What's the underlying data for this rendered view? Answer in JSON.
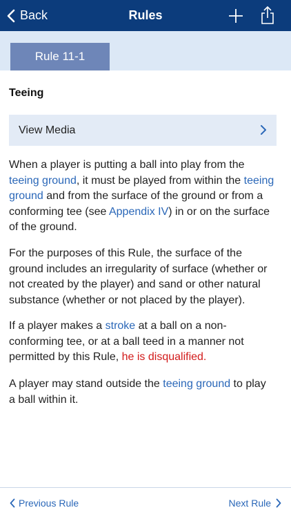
{
  "nav": {
    "back_label": "Back",
    "title": "Rules",
    "icons": [
      "chevron-left-icon",
      "plus-icon",
      "share-icon"
    ]
  },
  "rule_tab": {
    "label": "Rule 11-1"
  },
  "section": {
    "title": "Teeing"
  },
  "media": {
    "label": "View Media",
    "icon": "chevron-right-icon"
  },
  "paragraphs": [
    {
      "t0": "When a player is putting a ball into play from the ",
      "link1": "teeing ground",
      "t1": ", it must be played from within the ",
      "link2": "teeing ground",
      "t2": " and from the surface of the ground or from a conforming tee (see ",
      "link3": "Appendix IV",
      "t3": ") in or on the surface of the ground."
    },
    {
      "text": "For the purposes of this Rule, the surface of the ground includes an irregularity of surface (whether or not created by the player) and sand or other natural substance (whether or not placed by the player)."
    },
    {
      "t0": "If a player makes a ",
      "link1": "stroke",
      "t1": " at a ball on a non-conforming tee, or at a ball teed in a manner not permitted by this Rule, ",
      "penalty": "he is disqualified",
      "t2": "."
    },
    {
      "t0": "A player may stand outside the ",
      "link1": "teeing ground",
      "t1": " to play a ball within it."
    }
  ],
  "footer": {
    "prev_label": "Previous Rule",
    "next_label": "Next Rule"
  },
  "colors": {
    "nav_bg": "#0c3c7c",
    "tab_band": "#dce8f6",
    "tab": "#6e86b8",
    "media_bg": "#e3ebf6",
    "link": "#2a67b8",
    "penalty": "#d21a1a"
  }
}
